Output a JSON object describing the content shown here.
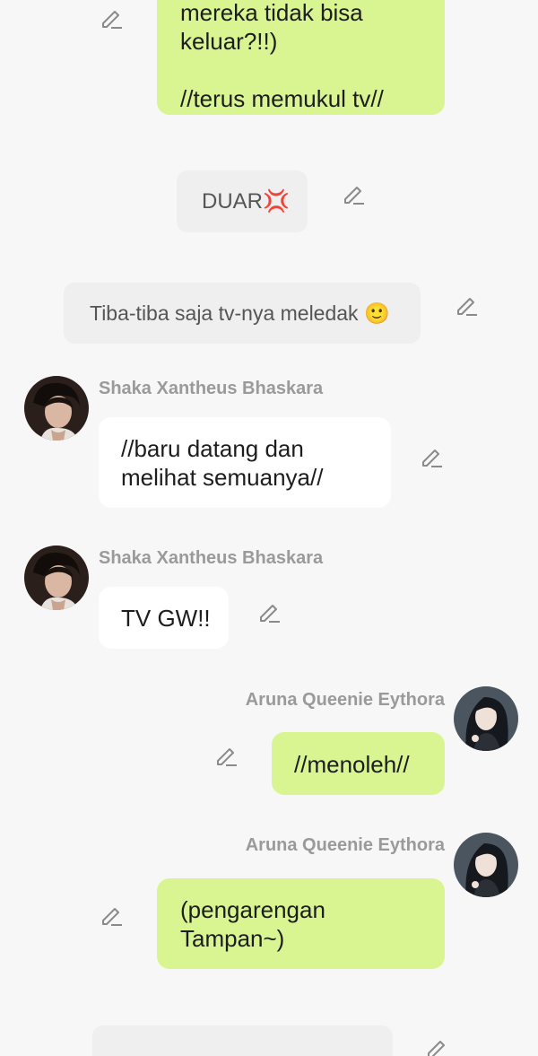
{
  "messages": [
    {
      "id": "m1",
      "text": "mereka tidak bisa\nkeluar?!!)\n\n//terus memukul tv//",
      "style": "green"
    },
    {
      "id": "m2",
      "text": "DUAR💢",
      "style": "grey"
    },
    {
      "id": "m3",
      "text": "Tiba-tiba saja tv-nya meledak 🙂",
      "style": "grey"
    },
    {
      "id": "m4",
      "sender": "Shaka Xantheus Bhaskara",
      "text": "//baru datang dan\nmelihat semuanya//",
      "style": "white",
      "avatar": "male-avatar"
    },
    {
      "id": "m5",
      "sender": "Shaka Xantheus Bhaskara",
      "text": "TV GW!!",
      "style": "white",
      "avatar": "male-avatar"
    },
    {
      "id": "m6",
      "sender": "Aruna Queenie Eythora",
      "text": "//menoleh//",
      "style": "green",
      "avatar": "female-avatar"
    },
    {
      "id": "m7",
      "sender": "Aruna Queenie Eythora",
      "text": "(pengarengan\nTampan~)",
      "style": "green",
      "avatar": "female-avatar"
    },
    {
      "id": "m8",
      "text": "",
      "style": "grey"
    }
  ],
  "colors": {
    "background": "#f7f7f8",
    "green_bubble": "#d8f592",
    "white_bubble": "#ffffff",
    "grey_bubble": "#efefef",
    "sender_name": "#9a9a9a"
  },
  "icons": {
    "edit": "pencil-edit-icon"
  }
}
